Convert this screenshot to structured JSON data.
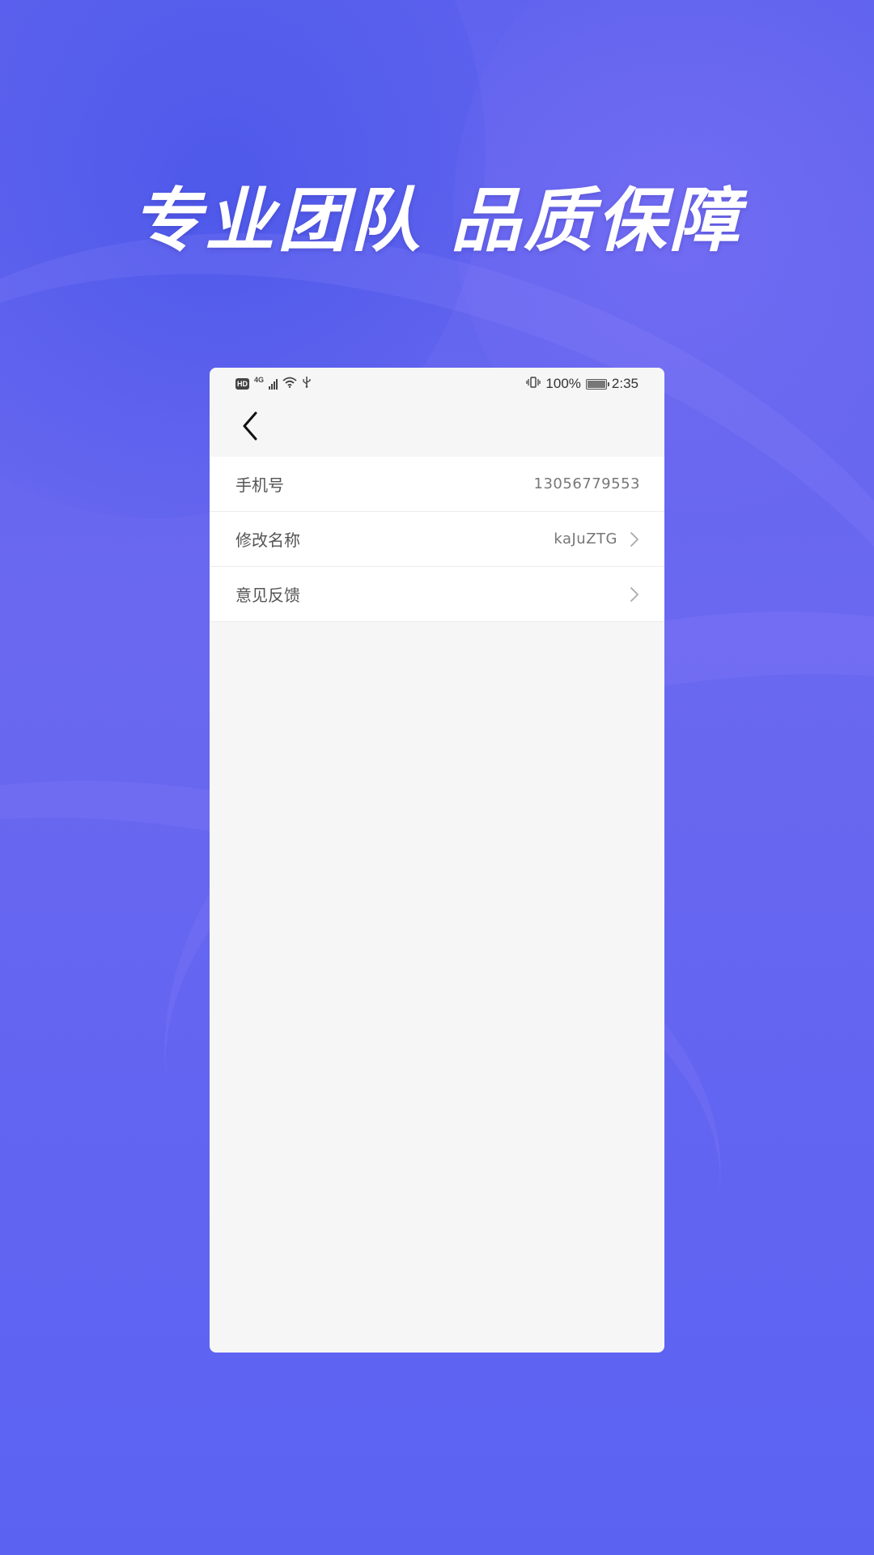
{
  "banner": {
    "headline": "专业团队 品质保障"
  },
  "status_bar": {
    "hd_label": "HD",
    "network_label": "4G",
    "battery_percent_label": "100%",
    "battery_level": 1.0,
    "time": "2:35"
  },
  "nav": {
    "back_icon": "chevron-left-icon"
  },
  "settings": {
    "rows": [
      {
        "label": "手机号",
        "value": "13056779553",
        "has_chevron": false
      },
      {
        "label": "修改名称",
        "value": "kaJuZTG",
        "has_chevron": true
      },
      {
        "label": "意见反馈",
        "value": "",
        "has_chevron": true
      }
    ]
  },
  "colors": {
    "background": "#6066ef",
    "panel": "#f6f6f6",
    "row_bg": "#ffffff"
  }
}
